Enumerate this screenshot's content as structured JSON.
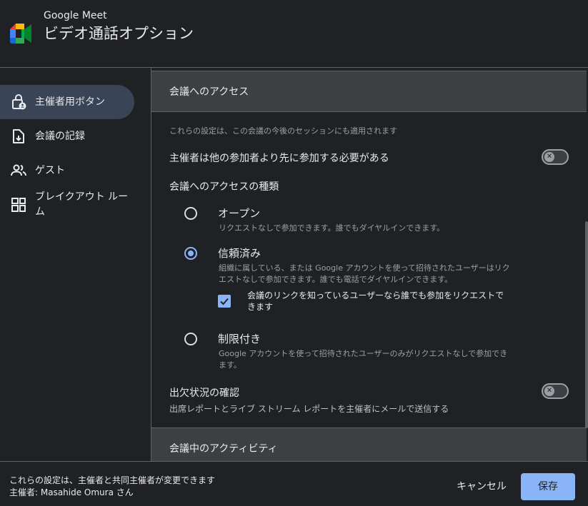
{
  "header": {
    "app_name": "Google Meet",
    "title": "ビデオ通話オプション"
  },
  "sidebar": {
    "items": [
      {
        "label": "主催者用ボタン",
        "icon": "lock-person-icon",
        "active": true
      },
      {
        "label": "会議の記録",
        "icon": "file-download-icon",
        "active": false
      },
      {
        "label": "ゲスト",
        "icon": "people-icon",
        "active": false
      },
      {
        "label": "ブレイクアウト ルーム",
        "label_line1": "ブレイクアウト ルー",
        "label_line2": "ム",
        "icon": "grid-icon",
        "active": false
      }
    ]
  },
  "content": {
    "section1_title": "会議へのアクセス",
    "section1_note": "これらの設定は、この会議の今後のセッションにも適用されます",
    "host_join_first": {
      "label": "主催者は他の参加者より先に参加する必要がある",
      "on": false
    },
    "access_type_title": "会議へのアクセスの種類",
    "options": [
      {
        "title": "オープン",
        "desc": "リクエストなしで参加できます。誰でもダイヤルインできます。",
        "checked": false
      },
      {
        "title": "信頼済み",
        "desc_line1": "組織に属している、または Google アカウントを使って招待されたユーザーはリク",
        "desc_line2": "エストなしで参加できます。誰でも電話でダイヤルインできます。",
        "checked": true
      },
      {
        "title": "制限付き",
        "desc_line1": "Google アカウントを使って招待されたユーザーのみがリクエストなしで参加でき",
        "desc_line2": "ます。",
        "checked": false
      }
    ],
    "link_request": {
      "label_line1": "会議のリンクを知っているユーザーなら誰でも参加をリクエストで",
      "label_line2": "きます",
      "checked": true
    },
    "attendance": {
      "title": "出欠状況の確認",
      "desc": "出席レポートとライブ ストリーム レポートを主催者にメールで送信する",
      "on": false
    },
    "section2_title": "会議中のアクティビティ"
  },
  "footer": {
    "note_line1": "これらの設定は、主催者と共同主催者が変更できます",
    "note_line2": "主催者: Masahide Omura さん",
    "cancel_label": "キャンセル",
    "save_label": "保存"
  },
  "colors": {
    "background": "#202124",
    "section_header": "#3c4043",
    "active_nav": "#394457",
    "accent": "#8ab4f8"
  }
}
